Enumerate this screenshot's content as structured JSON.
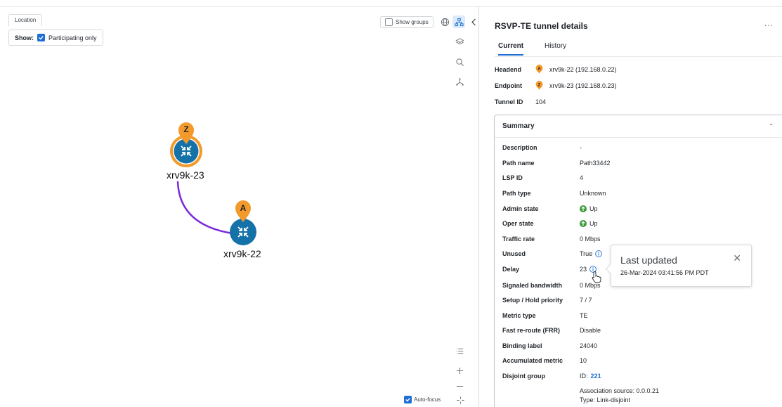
{
  "map": {
    "location_tab": "Location",
    "show_label": "Show:",
    "participating_only": "Participating only",
    "show_groups": "Show groups",
    "auto_focus": "Auto-focus",
    "nodes": [
      {
        "name": "xrv9k-23",
        "marker": "Z"
      },
      {
        "name": "xrv9k-22",
        "marker": "A"
      }
    ],
    "link_color": "#7a2bd9",
    "node_color": "#1572a8",
    "marker_color": "#f39a2b"
  },
  "panel": {
    "title": "RSVP-TE tunnel details",
    "more": "...",
    "tabs": [
      {
        "label": "Current",
        "active": true
      },
      {
        "label": "History",
        "active": false
      }
    ],
    "headend": {
      "label": "Headend",
      "marker": "A",
      "value": "xrv9k-22 (192.168.0.22)"
    },
    "endpoint": {
      "label": "Endpoint",
      "marker": "Z",
      "value": "xrv9k-23 (192.168.0.23)"
    },
    "tunnel_id": {
      "label": "Tunnel ID",
      "value": "104"
    },
    "summary": {
      "title": "Summary",
      "rows": [
        {
          "key": "Description",
          "value": "-"
        },
        {
          "key": "Path name",
          "value": "Path33442"
        },
        {
          "key": "LSP ID",
          "value": "4"
        },
        {
          "key": "Path type",
          "value": "Unknown"
        },
        {
          "key": "Admin state",
          "value": "Up"
        },
        {
          "key": "Oper state",
          "value": "Up"
        },
        {
          "key": "Traffic rate",
          "value": "0 Mbps"
        },
        {
          "key": "Unused",
          "value": "True"
        },
        {
          "key": "Delay",
          "value": "23"
        },
        {
          "key": "Signaled bandwidth",
          "value": "0 Mbps"
        },
        {
          "key": "Setup / Hold priority",
          "value": "7 / 7"
        },
        {
          "key": "Metric type",
          "value": "TE"
        },
        {
          "key": "Fast re-route (FRR)",
          "value": "Disable"
        },
        {
          "key": "Binding label",
          "value": "24040"
        },
        {
          "key": "Accumulated metric",
          "value": "10"
        },
        {
          "key": "Disjoint group",
          "value_prefix": "ID: ",
          "value": "221"
        }
      ],
      "association_source": "Association source: 0.0.0.21",
      "association_type": "Type: Link-disjoint"
    }
  },
  "tooltip": {
    "title": "Last updated",
    "timestamp": "26-Mar-2024 03:41:56 PM PDT",
    "close": "✕"
  }
}
